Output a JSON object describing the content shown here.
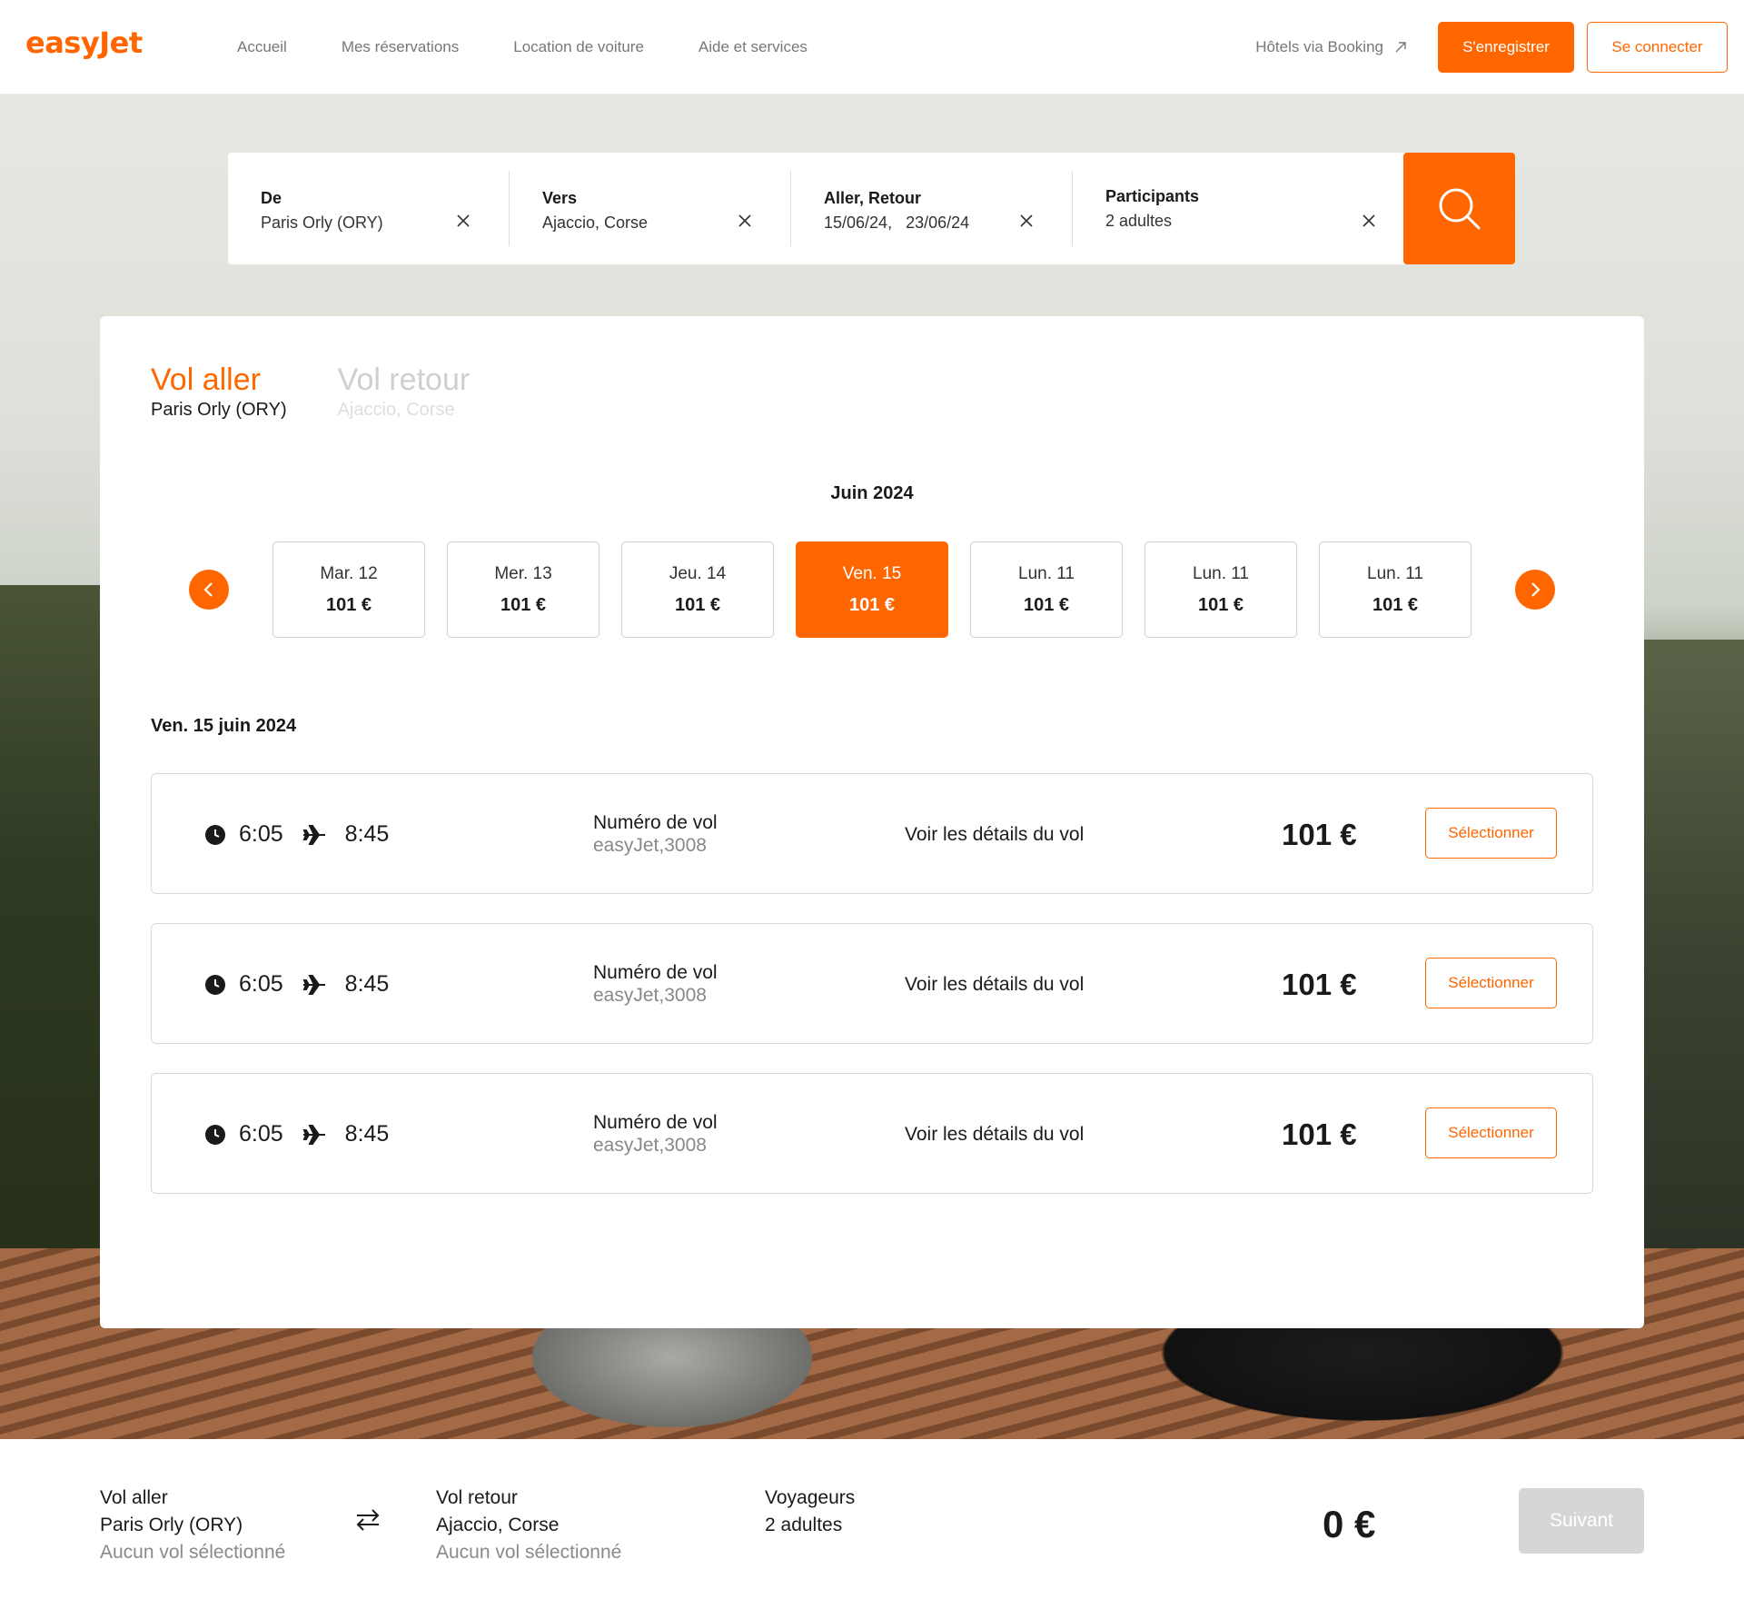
{
  "header": {
    "logo": "easyJet",
    "nav": [
      "Accueil",
      "Mes réservations",
      "Location de voiture",
      "Aide et services"
    ],
    "hotels_link": "Hôtels via Booking",
    "register_label": "S'enregistrer",
    "login_label": "Se connecter"
  },
  "search": {
    "from_label": "De",
    "from_value": "Paris Orly (ORY)",
    "to_label": "Vers",
    "to_value": "Ajaccio, Corse",
    "dates_label": "Aller, Retour",
    "dates_value": "15/06/24,   23/06/24",
    "participants_label": "Participants",
    "participants_value": "2 adultes"
  },
  "tabs": [
    {
      "title": "Vol aller",
      "subtitle": "Paris Orly (ORY)"
    },
    {
      "title": "Vol retour",
      "subtitle": "Ajaccio, Corse"
    }
  ],
  "calendar": {
    "month": "Juin 2024",
    "dates": [
      {
        "label": "Mar. 12",
        "price": "101 €"
      },
      {
        "label": "Mer. 13",
        "price": "101 €"
      },
      {
        "label": "Jeu. 14",
        "price": "101 €"
      },
      {
        "label": "Ven. 15",
        "price": "101 €"
      },
      {
        "label": "Lun. 11",
        "price": "101 €"
      },
      {
        "label": "Lun. 11",
        "price": "101 €"
      },
      {
        "label": "Lun. 11",
        "price": "101 €"
      }
    ],
    "selected_index": 3
  },
  "day_heading": "Ven. 15 juin 2024",
  "flights": [
    {
      "depart": "6:05",
      "arrive": "8:45",
      "num_label": "Numéro de vol",
      "num_value": "easyJet,3008",
      "details": "Voir les détails du vol",
      "price": "101 €",
      "select_label": "Sélectionner"
    },
    {
      "depart": "6:05",
      "arrive": "8:45",
      "num_label": "Numéro de vol",
      "num_value": "easyJet,3008",
      "details": "Voir les détails du vol",
      "price": "101 €",
      "select_label": "Sélectionner"
    },
    {
      "depart": "6:05",
      "arrive": "8:45",
      "num_label": "Numéro de vol",
      "num_value": "easyJet,3008",
      "details": "Voir les détails du vol",
      "price": "101 €",
      "select_label": "Sélectionner"
    }
  ],
  "summary": {
    "outbound_title": "Vol aller",
    "outbound_place": "Paris Orly (ORY)",
    "outbound_status": "Aucun vol sélectionné",
    "return_title": "Vol retour",
    "return_place": "Ajaccio, Corse",
    "return_status": "Aucun vol sélectionné",
    "travellers_title": "Voyageurs",
    "travellers_value": "2 adultes",
    "total": "0 €",
    "next_label": "Suivant"
  },
  "colors": {
    "accent": "#ff6600",
    "disabled": "#d6d6d6"
  },
  "icons": [
    "close-icon",
    "search-icon",
    "chevron-left-icon",
    "chevron-right-icon",
    "clock-icon",
    "plane-icon",
    "swap-icon",
    "external-link-icon"
  ]
}
